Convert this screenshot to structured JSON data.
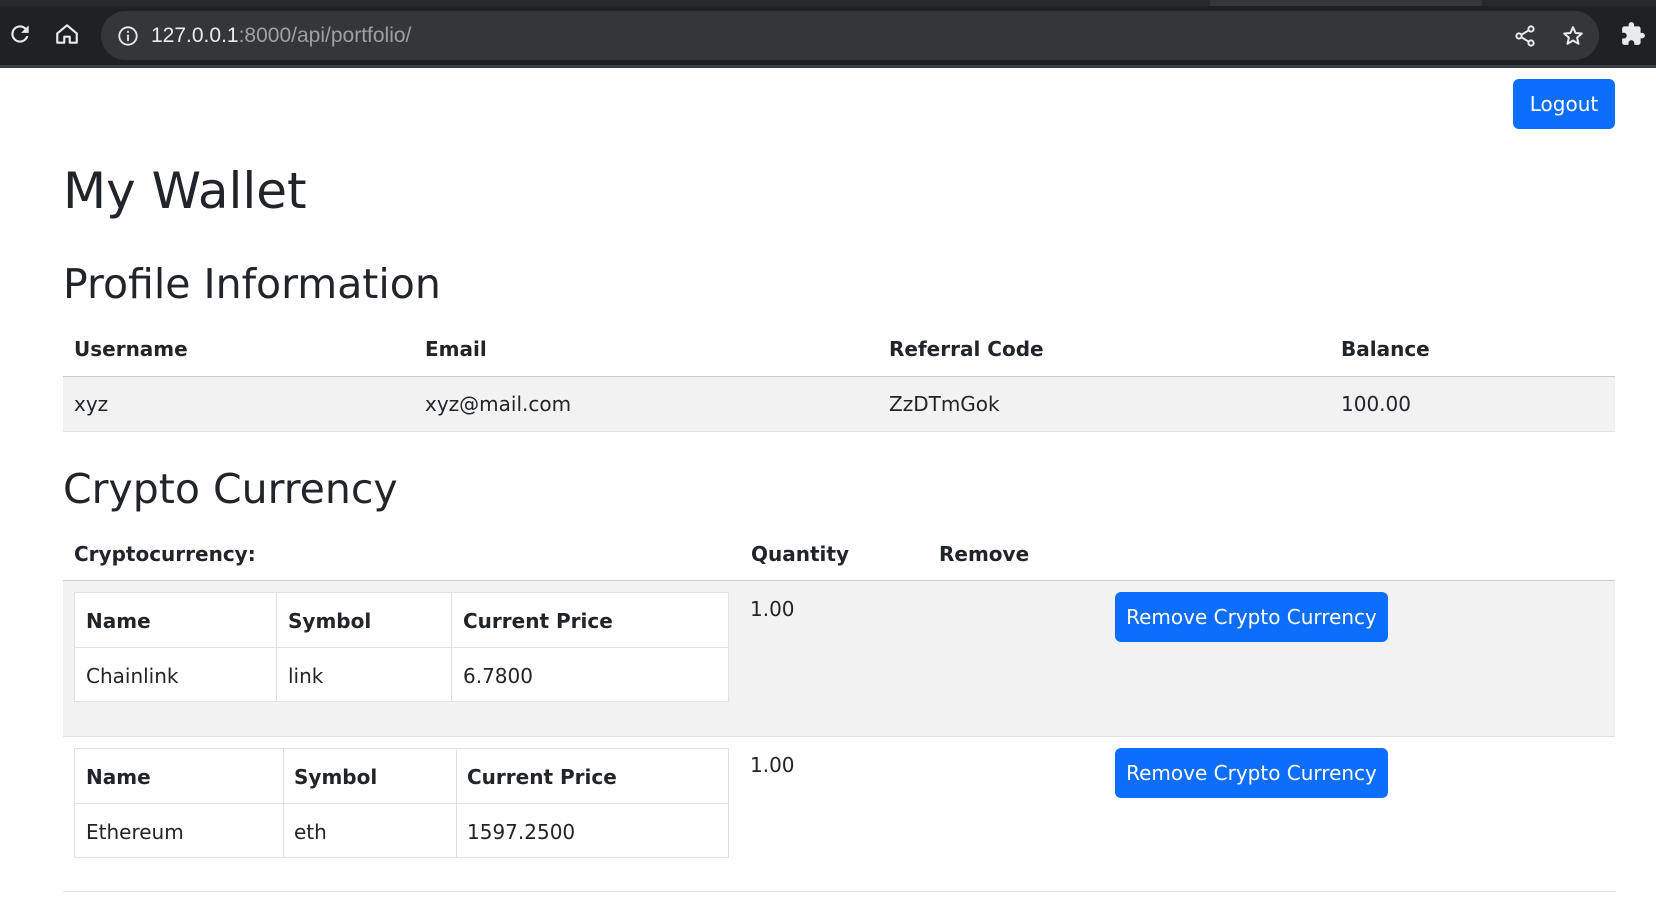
{
  "browser": {
    "url_host": "127.0.0.1",
    "url_rest": ":8000/api/portfolio/"
  },
  "header": {
    "logout_label": "Logout"
  },
  "page": {
    "title": "My Wallet",
    "profile_heading": "Profile Information",
    "crypto_heading": "Crypto Currency"
  },
  "profile": {
    "headers": [
      "Username",
      "Email",
      "Referral Code",
      "Balance"
    ],
    "row": [
      "xyz",
      "xyz@mail.com",
      "ZzDTmGok",
      "100.00"
    ]
  },
  "holdings": {
    "headers": [
      "Cryptocurrency:",
      "Quantity",
      "Remove"
    ],
    "inner_headers": [
      "Name",
      "Symbol",
      "Current Price"
    ],
    "rows": [
      {
        "name": "Chainlink",
        "symbol": "link",
        "price": "6.7800",
        "quantity": "1.00",
        "remove_label": "Remove Crypto Currency"
      },
      {
        "name": "Ethereum",
        "symbol": "eth",
        "price": "1597.2500",
        "quantity": "1.00",
        "remove_label": "Remove Crypto Currency"
      }
    ]
  },
  "colors": {
    "primary": "#0d6efd",
    "stripe": "#f2f2f2",
    "chrome": "#202124"
  },
  "icons": [
    "reload-icon",
    "home-icon",
    "info-icon",
    "share-icon",
    "star-icon",
    "extensions-icon"
  ]
}
